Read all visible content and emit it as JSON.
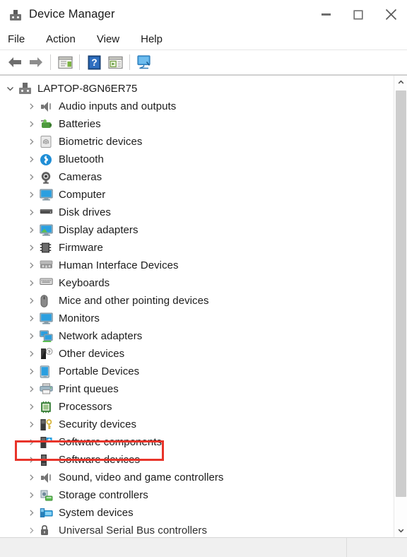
{
  "window": {
    "title": "Device Manager",
    "icon": "device-manager-icon",
    "controls": {
      "minimize": "minimize-button",
      "maximize": "maximize-button",
      "close": "close-button"
    }
  },
  "menubar": {
    "items": [
      {
        "label": "File"
      },
      {
        "label": "Action"
      },
      {
        "label": "View"
      },
      {
        "label": "Help"
      }
    ]
  },
  "toolbar": {
    "buttons": [
      {
        "name": "back-arrow-icon",
        "tip": "Back"
      },
      {
        "name": "forward-arrow-icon",
        "tip": "Forward"
      },
      {
        "name": "properties-icon",
        "tip": "Properties"
      },
      {
        "name": "help-icon",
        "tip": "Help"
      },
      {
        "name": "update-driver-icon",
        "tip": "Update driver"
      },
      {
        "name": "scan-hardware-icon",
        "tip": "Scan for hardware changes"
      }
    ]
  },
  "tree": {
    "root": {
      "label": "LAPTOP-8GN6ER75",
      "expanded": true,
      "icon": "computer-root-icon"
    },
    "nodes": [
      {
        "label": "Audio inputs and outputs",
        "icon": "speaker-icon"
      },
      {
        "label": "Batteries",
        "icon": "battery-icon"
      },
      {
        "label": "Biometric devices",
        "icon": "fingerprint-icon"
      },
      {
        "label": "Bluetooth",
        "icon": "bluetooth-icon"
      },
      {
        "label": "Cameras",
        "icon": "camera-icon"
      },
      {
        "label": "Computer",
        "icon": "monitor-icon"
      },
      {
        "label": "Disk drives",
        "icon": "disk-drive-icon"
      },
      {
        "label": "Display adapters",
        "icon": "display-adapter-icon"
      },
      {
        "label": "Firmware",
        "icon": "firmware-icon"
      },
      {
        "label": "Human Interface Devices",
        "icon": "hid-icon"
      },
      {
        "label": "Keyboards",
        "icon": "keyboard-icon"
      },
      {
        "label": "Mice and other pointing devices",
        "icon": "mouse-icon"
      },
      {
        "label": "Monitors",
        "icon": "monitor-icon"
      },
      {
        "label": "Network adapters",
        "icon": "network-adapter-icon"
      },
      {
        "label": "Other devices",
        "icon": "other-devices-icon"
      },
      {
        "label": "Portable Devices",
        "icon": "portable-device-icon",
        "highlighted": true
      },
      {
        "label": "Print queues",
        "icon": "printer-icon"
      },
      {
        "label": "Processors",
        "icon": "processor-icon"
      },
      {
        "label": "Security devices",
        "icon": "security-device-icon"
      },
      {
        "label": "Software components",
        "icon": "software-component-icon"
      },
      {
        "label": "Software devices",
        "icon": "software-device-icon"
      },
      {
        "label": "Sound, video and game controllers",
        "icon": "speaker-icon"
      },
      {
        "label": "Storage controllers",
        "icon": "storage-controller-icon"
      },
      {
        "label": "System devices",
        "icon": "system-device-icon"
      },
      {
        "label": "Universal Serial Bus controllers",
        "icon": "usb-controller-icon"
      }
    ]
  },
  "scrollbar": {
    "up": "scroll-up-arrow",
    "down": "scroll-down-arrow"
  },
  "colors": {
    "highlight": "#e8342a",
    "accent_blue": "#1f8ed6",
    "green": "#4e9a3e",
    "titlebar_bg": "#ffffff",
    "statusbar_bg": "#f0f0f0"
  }
}
